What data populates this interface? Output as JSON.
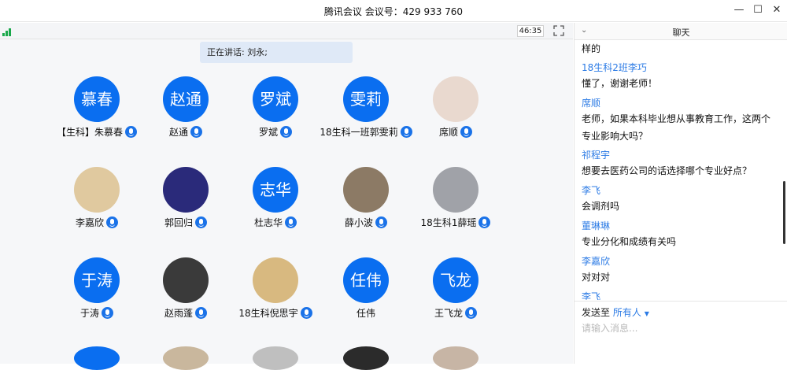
{
  "window": {
    "title": "腾讯会议  会议号：429 933 760"
  },
  "toolbar": {
    "timer": "46:35"
  },
  "speaking": {
    "label": "正在讲话: 刘永;"
  },
  "participants": [
    {
      "initials": "慕春",
      "name": "【生科】朱慕春",
      "photo": false
    },
    {
      "initials": "赵通",
      "name": "赵通",
      "photo": false
    },
    {
      "initials": "罗斌",
      "name": "罗斌",
      "photo": false
    },
    {
      "initials": "雯莉",
      "name": "18生科一班郭雯莉",
      "photo": false
    },
    {
      "initials": "",
      "name": "席顺",
      "photo": true,
      "photo_color": "#e9d9cf"
    },
    {
      "initials": "",
      "name": "李嘉欣",
      "photo": true,
      "photo_color": "#e0c99f"
    },
    {
      "initials": "",
      "name": "郭回归",
      "photo": true,
      "photo_color": "#2a2a7a"
    },
    {
      "initials": "志华",
      "name": "杜志华",
      "photo": false
    },
    {
      "initials": "",
      "name": "薛小波",
      "photo": true,
      "photo_color": "#8c7a65"
    },
    {
      "initials": "",
      "name": "18生科1薛瑶",
      "photo": true,
      "photo_color": "#a0a2a8"
    },
    {
      "initials": "于涛",
      "name": "于涛",
      "photo": false
    },
    {
      "initials": "",
      "name": "赵雨蓬",
      "photo": true,
      "photo_color": "#3a3a3a"
    },
    {
      "initials": "",
      "name": "18生科倪思宇",
      "photo": true,
      "photo_color": "#d8b980"
    },
    {
      "initials": "任伟",
      "name": "任伟",
      "photo": false,
      "mic": false
    },
    {
      "initials": "飞龙",
      "name": "王飞龙",
      "photo": false
    }
  ],
  "chat": {
    "title": "聊天",
    "messages": [
      {
        "sender": "",
        "text": "样的"
      },
      {
        "sender": "18生科2班李巧",
        "text": "懂了，谢谢老师！"
      },
      {
        "sender": "席顺",
        "text": "老师，如果本科毕业想从事教育工作，这两个专业影响大吗？"
      },
      {
        "sender": "祁程宇",
        "text": "想要去医药公司的话选择哪个专业好点？"
      },
      {
        "sender": "李飞",
        "text": "会调剂吗"
      },
      {
        "sender": "董琳琳",
        "text": "专业分化和成绩有关吗"
      },
      {
        "sender": "李嘉欣",
        "text": "对对对"
      },
      {
        "sender": "李飞",
        "text": ""
      }
    ],
    "send_to_label": "发送至",
    "send_to_target": "所有人",
    "input_placeholder": "请输入消息..."
  },
  "colors": {
    "accent": "#0a6ef0",
    "link": "#2c7be5",
    "signal": "#19a84a"
  }
}
